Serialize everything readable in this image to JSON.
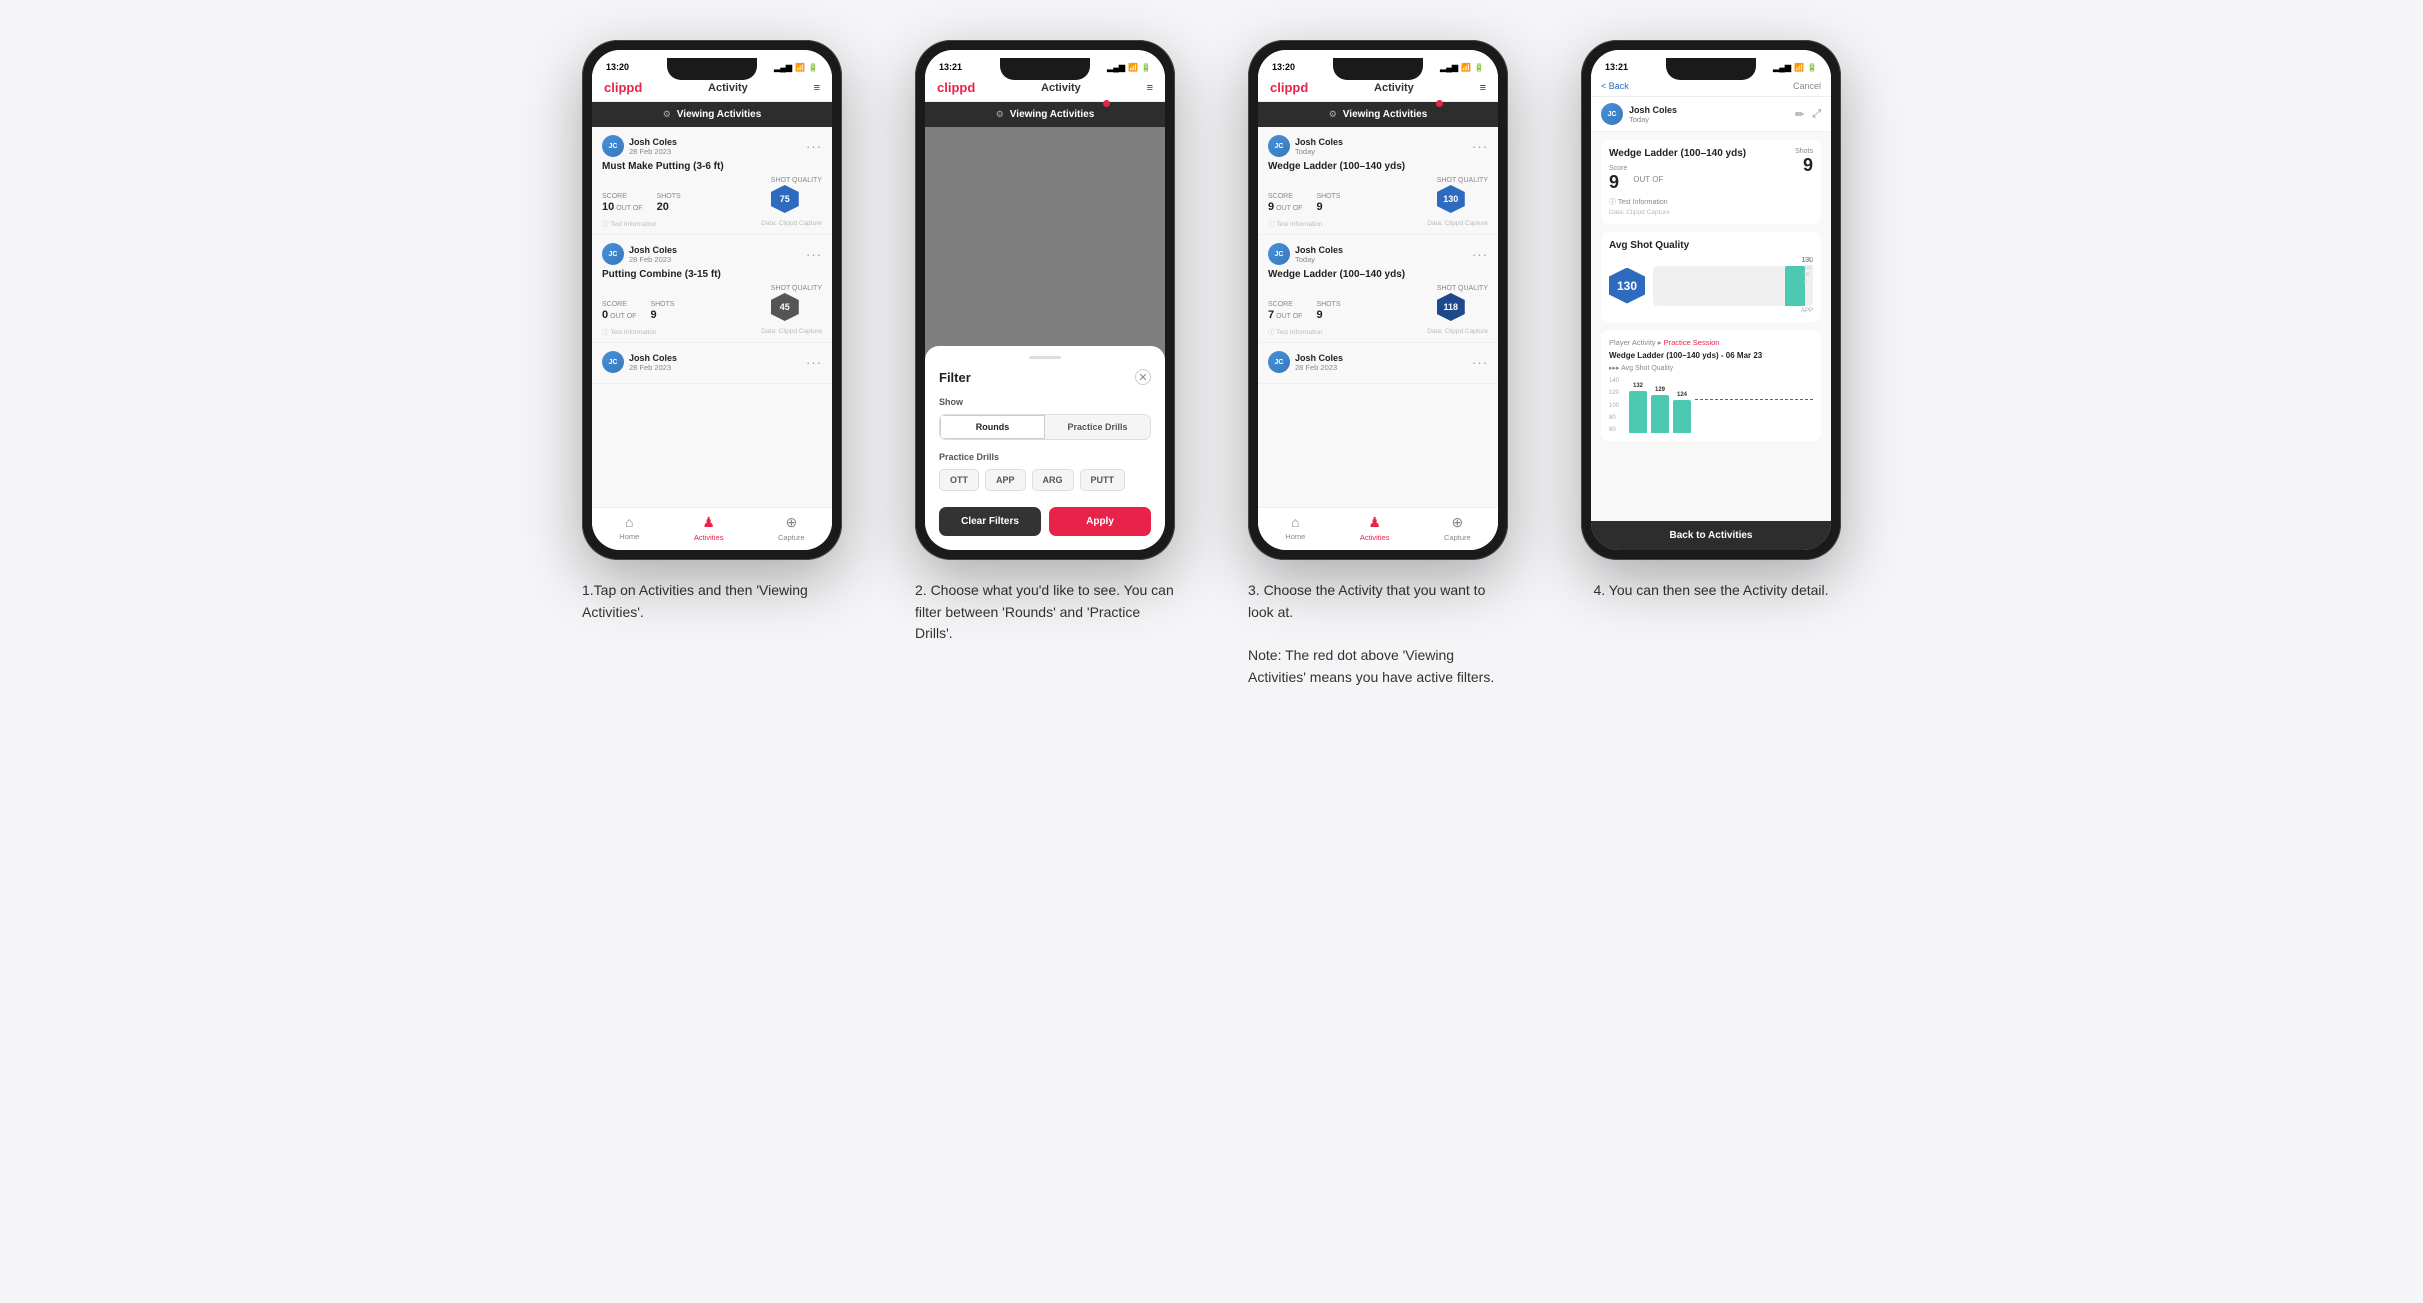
{
  "steps": [
    {
      "id": "step1",
      "caption": "1.Tap on Activities and then 'Viewing Activities'.",
      "phone": {
        "statusBar": {
          "time": "13:20",
          "signal": "▂▄▆",
          "wifi": "wifi",
          "battery": "■■"
        },
        "header": {
          "logo": "clippd",
          "title": "Activity",
          "menuIcon": "≡"
        },
        "viewingBar": {
          "text": "Viewing Activities",
          "hasDot": false
        },
        "cards": [
          {
            "user": "Josh Coles",
            "date": "28 Feb 2023",
            "title": "Must Make Putting (3-6 ft)",
            "scoreLabel": "Score",
            "shotsLabel": "Shots",
            "qualityLabel": "Shot Quality",
            "score": "10",
            "shots": "20",
            "quality": "75",
            "hasHex": true
          },
          {
            "user": "Josh Coles",
            "date": "28 Feb 2023",
            "title": "Putting Combine (3-15 ft)",
            "scoreLabel": "Score",
            "shotsLabel": "Shots",
            "qualityLabel": "Shot Quality",
            "score": "0",
            "shots": "9",
            "quality": "45",
            "hasHex": true
          },
          {
            "user": "Josh Coles",
            "date": "28 Feb 2023",
            "title": "",
            "score": "",
            "shots": "",
            "quality": ""
          }
        ],
        "bottomNav": [
          {
            "label": "Home",
            "icon": "⌂",
            "active": false
          },
          {
            "label": "Activities",
            "icon": "☰",
            "active": true
          },
          {
            "label": "Capture",
            "icon": "⊕",
            "active": false
          }
        ]
      }
    },
    {
      "id": "step2",
      "caption": "2. Choose what you'd like to see. You can filter between 'Rounds' and 'Practice Drills'.",
      "phone": {
        "statusBar": {
          "time": "13:21",
          "signal": "▂▄▆",
          "wifi": "wifi",
          "battery": "■■"
        },
        "header": {
          "logo": "clippd",
          "title": "Activity",
          "menuIcon": "≡"
        },
        "viewingBar": {
          "text": "Viewing Activities",
          "hasDot": true
        },
        "filter": {
          "title": "Filter",
          "showLabel": "Show",
          "toggles": [
            "Rounds",
            "Practice Drills"
          ],
          "activeToggle": 0,
          "practiceLabel": "Practice Drills",
          "drillButtons": [
            "OTT",
            "APP",
            "ARG",
            "PUTT"
          ],
          "clearLabel": "Clear Filters",
          "applyLabel": "Apply"
        }
      }
    },
    {
      "id": "step3",
      "caption": "3. Choose the Activity that you want to look at.\n\nNote: The red dot above 'Viewing Activities' means you have active filters.",
      "captionParts": [
        "3. Choose the Activity that you want to look at.",
        "Note: The red dot above 'Viewing Activities' means you have active filters."
      ],
      "phone": {
        "statusBar": {
          "time": "13:20",
          "signal": "▂▄▆",
          "wifi": "wifi",
          "battery": "■■"
        },
        "header": {
          "logo": "clippd",
          "title": "Activity",
          "menuIcon": "≡"
        },
        "viewingBar": {
          "text": "Viewing Activities",
          "hasDot": true
        },
        "cards": [
          {
            "user": "Josh Coles",
            "date": "Today",
            "title": "Wedge Ladder (100–140 yds)",
            "scoreLabel": "Score",
            "shotsLabel": "Shots",
            "qualityLabel": "Shot Quality",
            "score": "9",
            "shots": "9",
            "quality": "130",
            "hexColor": "blue"
          },
          {
            "user": "Josh Coles",
            "date": "Today",
            "title": "Wedge Ladder (100–140 yds)",
            "scoreLabel": "Score",
            "shotsLabel": "Shots",
            "qualityLabel": "Shot Quality",
            "score": "7",
            "shots": "9",
            "quality": "118",
            "hexColor": "darkblue"
          },
          {
            "user": "Josh Coles",
            "date": "28 Feb 2023",
            "title": "",
            "score": "",
            "shots": "",
            "quality": ""
          }
        ],
        "bottomNav": [
          {
            "label": "Home",
            "icon": "⌂",
            "active": false
          },
          {
            "label": "Activities",
            "icon": "☰",
            "active": true
          },
          {
            "label": "Capture",
            "icon": "⊕",
            "active": false
          }
        ]
      }
    },
    {
      "id": "step4",
      "caption": "4. You can then see the Activity detail.",
      "phone": {
        "statusBar": {
          "time": "13:21",
          "signal": "▂▄▆",
          "wifi": "wifi",
          "battery": "■■"
        },
        "backLabel": "< Back",
        "cancelLabel": "Cancel",
        "user": "Josh Coles",
        "userDate": "Today",
        "activityTitle": "Wedge Ladder (100–140 yds)",
        "scoreLabel": "Score",
        "shotsLabel": "Shots",
        "score": "9",
        "outOf": "OUT OF",
        "shots": "9",
        "avgQualityLabel": "Avg Shot Quality",
        "qualityValue": "130",
        "chartLabels": [
          "APP"
        ],
        "chartValues": [
          130
        ],
        "yAxisLabels": [
          "130",
          "100",
          "50",
          "0"
        ],
        "playerActivityLabel": "Player Activity",
        "practiceSessionLabel": "Practice Session",
        "sessionTitle": "Wedge Ladder (100–140 yds) - 06 Mar 23",
        "sessionSubtitle": "Avg Shot Quality",
        "barValues": [
          132,
          129,
          124
        ],
        "barLabels": [
          "132",
          "129",
          "124"
        ],
        "backToActivities": "Back to Activities"
      }
    }
  ]
}
